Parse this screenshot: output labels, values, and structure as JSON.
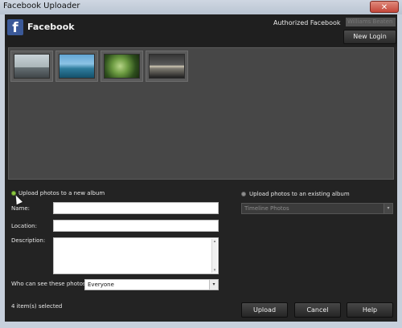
{
  "window": {
    "title": "Facebook Uploader",
    "close_glyph": "✕"
  },
  "header": {
    "logo_glyph": "f",
    "app_name": "Facebook",
    "auth_label": "Authorized Facebook",
    "user_name": "Williams Beaten",
    "new_login_label": "New Login"
  },
  "photos": {
    "thumbnails": [
      {
        "name": "thumbnail-1"
      },
      {
        "name": "thumbnail-2"
      },
      {
        "name": "thumbnail-3"
      },
      {
        "name": "thumbnail-4"
      }
    ]
  },
  "new_album": {
    "radio_label": "Upload photos to a new album",
    "name_label": "Name:",
    "name_value": "",
    "location_label": "Location:",
    "location_value": "",
    "description_label": "Description:",
    "description_value": "",
    "privacy_label": "Who can see these photos?",
    "privacy_value": "Everyone"
  },
  "existing_album": {
    "radio_label": "Upload photos to an existing album",
    "album_value": "Timeline Photos"
  },
  "footer": {
    "selection_status": "4 item(s) selected",
    "upload_label": "Upload",
    "cancel_label": "Cancel",
    "help_label": "Help"
  },
  "icons": {
    "select_arrow": "▾",
    "scroll_up": "▴",
    "scroll_down": "▾"
  },
  "colors": {
    "facebook_blue": "#3b5998",
    "selected_radio": "#8cc63f"
  }
}
